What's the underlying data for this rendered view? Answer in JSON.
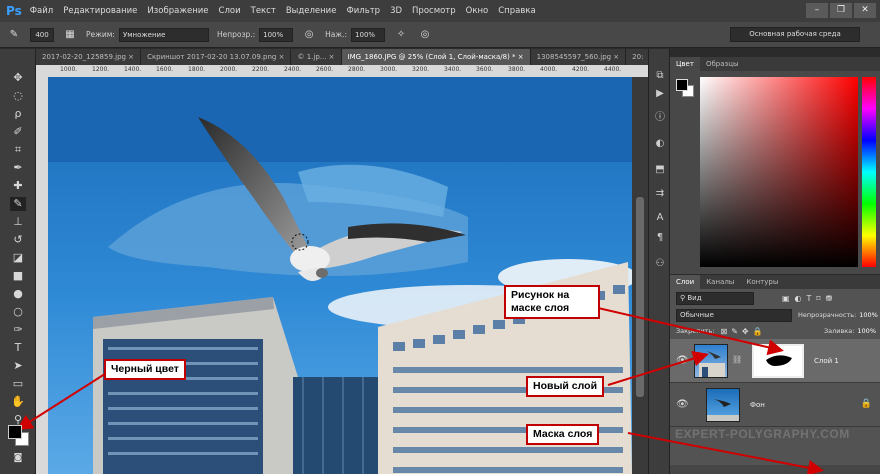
{
  "app": {
    "logo": "Ps"
  },
  "menu": [
    "Файл",
    "Редактирование",
    "Изображение",
    "Слои",
    "Текст",
    "Выделение",
    "Фильтр",
    "3D",
    "Просмотр",
    "Окно",
    "Справка"
  ],
  "options": {
    "brush_size": "400",
    "mode_label": "Режим:",
    "mode_value": "Умножение",
    "opacity_label": "Непрозр.:",
    "opacity_value": "100%",
    "pressure_label": "Наж.:",
    "pressure_value": "100%",
    "workspace": "Основная рабочая среда"
  },
  "tabs": [
    {
      "label": "2017-02-20_125859.jpg  ×",
      "active": false
    },
    {
      "label": "Скриншот 2017-02-20 13.07.09.png  ×",
      "active": false
    },
    {
      "label": "© 1.jp...  ×",
      "active": false
    },
    {
      "label": "IMG_1860.JPG @ 25% (Слой 1, Слой-маска/8) *  ×",
      "active": true
    },
    {
      "label": "1308545597_560.jpg  ×",
      "active": false
    },
    {
      "label": "20:",
      "active": false
    }
  ],
  "tab_overflow": "»",
  "ruler_ticks": [
    "1000.",
    "1200.",
    "1400.",
    "1600.",
    "1800.",
    "2000.",
    "2200.",
    "2400.",
    "2600.",
    "2800.",
    "3000.",
    "3200.",
    "3400.",
    "3600.",
    "3800.",
    "4000.",
    "4200.",
    "4400."
  ],
  "color_panel": {
    "tabs": [
      "Цвет",
      "Образцы"
    ]
  },
  "layers_panel": {
    "tabs": [
      "Слои",
      "Каналы",
      "Контуры"
    ],
    "filter_kind": "Вид",
    "blend_mode": "Обычные",
    "opacity_label": "Непрозрачность:",
    "opacity_value": "100%",
    "lock_label": "Закрепить:",
    "fill_label": "Заливка:",
    "fill_value": "100%",
    "layers": [
      {
        "name": "Слой 1",
        "selected": true
      },
      {
        "name": "Фон",
        "selected": false
      }
    ]
  },
  "annotations": {
    "mask_drawing": "Рисунок на маске слоя",
    "black_color": "Черный цвет",
    "new_layer": "Новый слой",
    "layer_mask": "Маска слоя"
  },
  "watermark": "EXPERT-POLYGRAPHY.COM"
}
